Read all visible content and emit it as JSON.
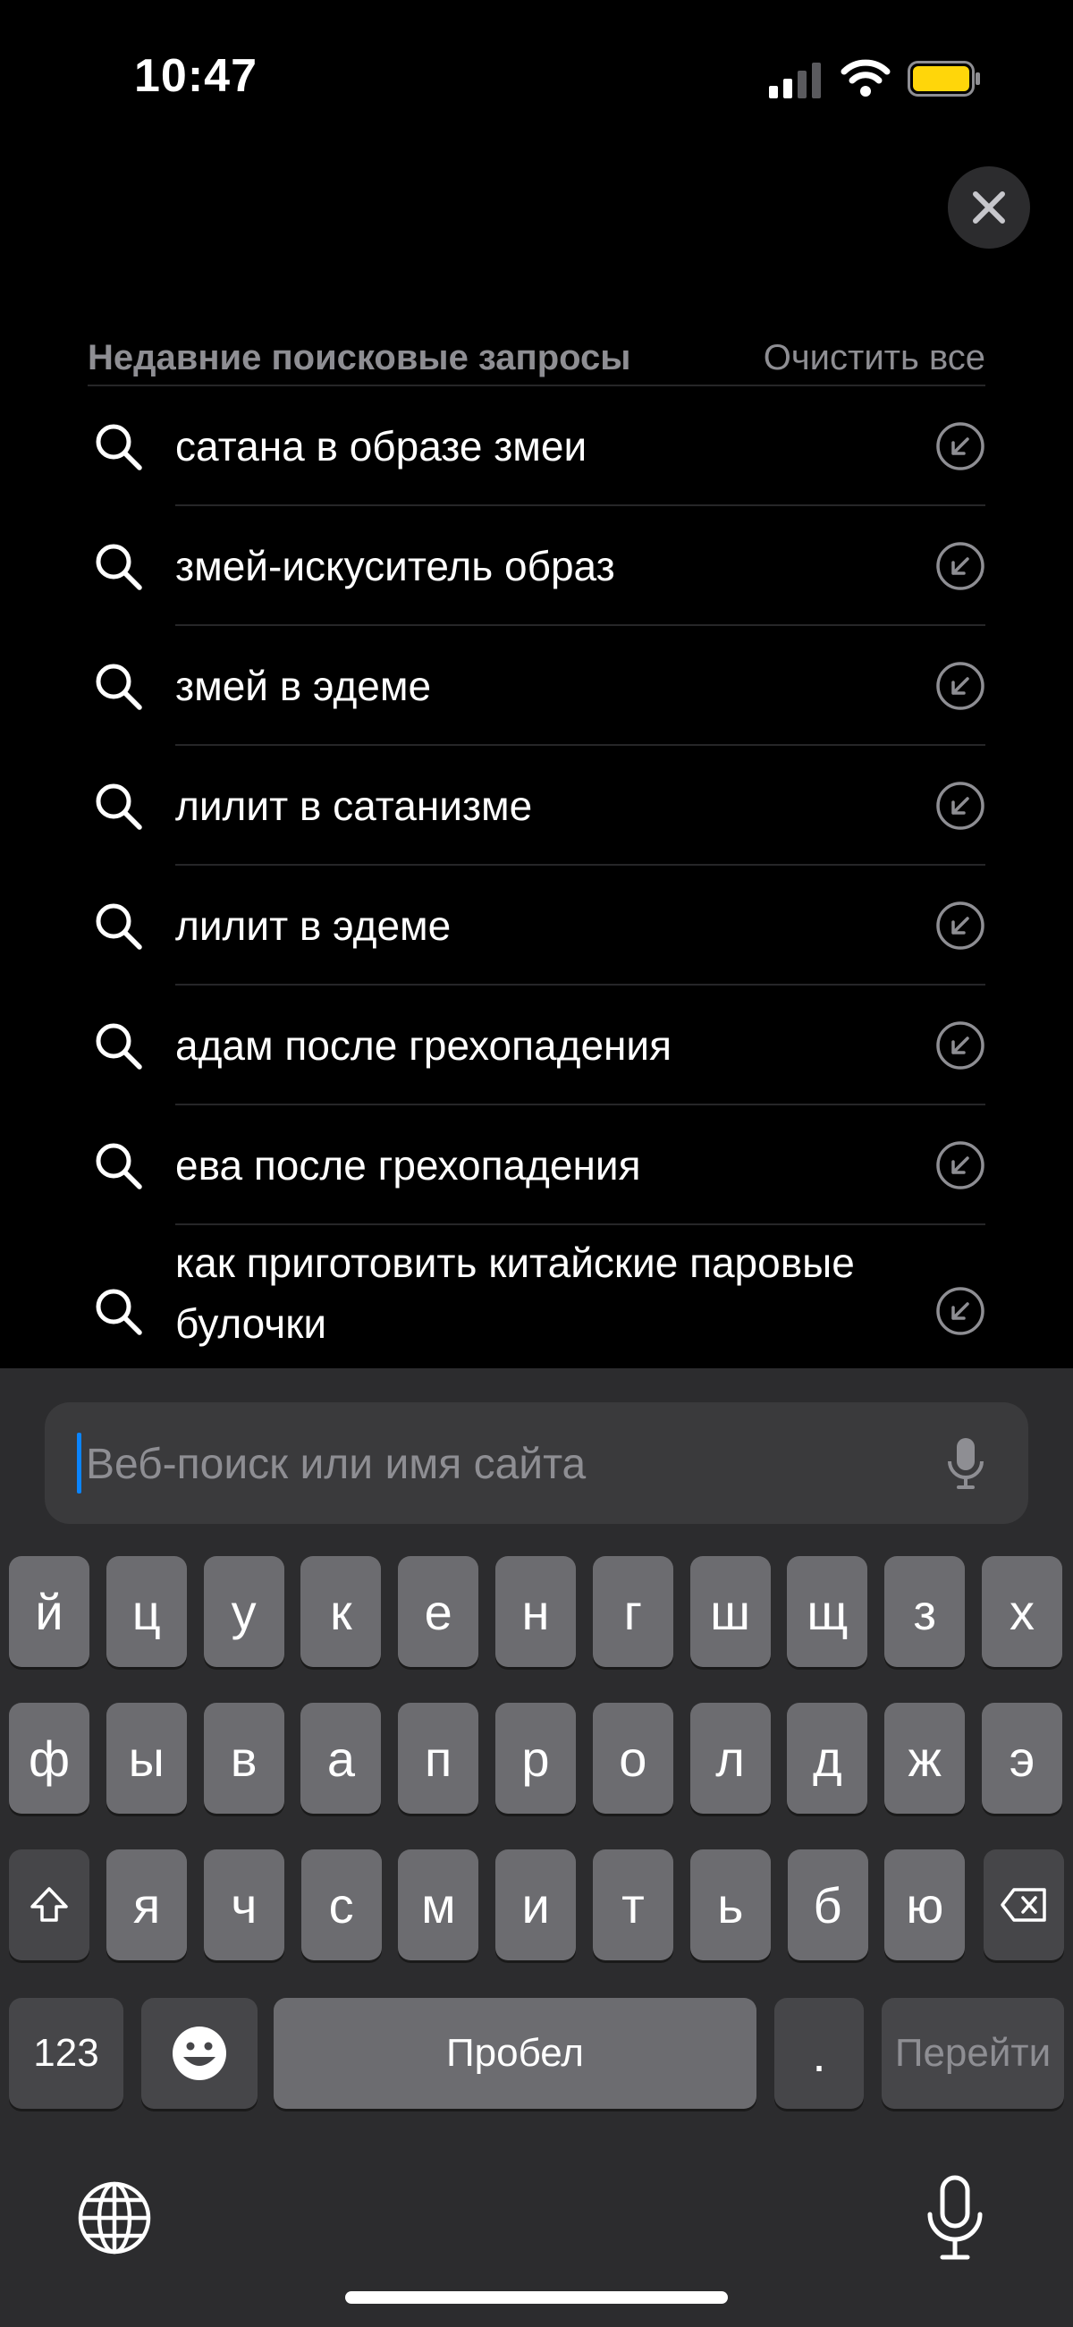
{
  "status_bar": {
    "time": "10:47"
  },
  "recent": {
    "title": "Недавние поисковые запросы",
    "clear_label": "Очистить все",
    "items": [
      "сатана в образе змеи",
      "змей-искуситель образ",
      "змей в эдеме",
      "лилит в сатанизме",
      "лилит в эдеме",
      "адам после грехопадения",
      "ева после грехопадения",
      "как приготовить китайские паровые булочки"
    ]
  },
  "search": {
    "placeholder": "Веб-поиск или имя сайта"
  },
  "keyboard": {
    "row1": [
      "й",
      "ц",
      "у",
      "к",
      "е",
      "н",
      "г",
      "ш",
      "щ",
      "з",
      "х"
    ],
    "row2": [
      "ф",
      "ы",
      "в",
      "а",
      "п",
      "р",
      "о",
      "л",
      "д",
      "ж",
      "э"
    ],
    "row3": [
      "я",
      "ч",
      "с",
      "м",
      "и",
      "т",
      "ь",
      "б",
      "ю"
    ],
    "numbers_label": "123",
    "space_label": "Пробел",
    "period_label": ".",
    "go_label": "Перейти"
  },
  "colors": {
    "accent": "#0a84ff",
    "battery": "#ffd60a"
  }
}
